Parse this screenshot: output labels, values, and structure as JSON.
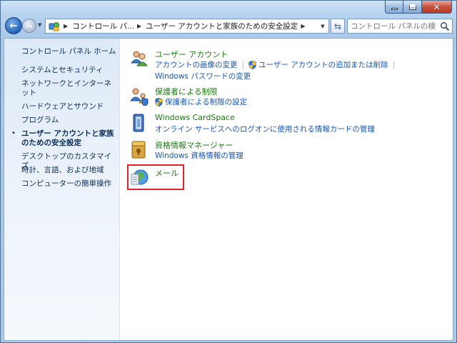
{
  "window": {
    "caption": {
      "close_glyph": "✕"
    }
  },
  "toolbar": {
    "address": {
      "segments": [
        "コントロール パ...",
        "ユーザー アカウントと家族のための安全設定"
      ]
    },
    "search": {
      "placeholder": "コントロール パネルの検索"
    }
  },
  "sidebar": {
    "items": [
      {
        "label": "コントロール パネル ホーム"
      },
      {
        "label": "システムとセキュリティ"
      },
      {
        "label": "ネットワークとインターネット"
      },
      {
        "label": "ハードウェアとサウンド"
      },
      {
        "label": "プログラム"
      },
      {
        "label": "ユーザー アカウントと家族のための安全設定",
        "current": true
      },
      {
        "label": "デスクトップのカスタマイズ"
      },
      {
        "label": "時計、言語、および地域"
      },
      {
        "label": "コンピューターの簡単操作"
      }
    ],
    "bullet": "•"
  },
  "categories": [
    {
      "title": "ユーザー アカウント",
      "icon": "users-icon",
      "links_row1": [
        "アカウントの画像の変更",
        "ユーザー アカウントの追加または削除"
      ],
      "links_row2": [
        "Windows パスワードの変更"
      ]
    },
    {
      "title": "保護者による制限",
      "icon": "parental-controls-icon",
      "links_row1": [
        "保護者による制限の設定"
      ]
    },
    {
      "title": "Windows CardSpace",
      "icon": "cardspace-icon",
      "links_row1": [
        "オンライン サービスへのログオンに使用される情報カードの管理"
      ]
    },
    {
      "title": "資格情報マネージャー",
      "icon": "credential-manager-icon",
      "links_row1": [
        "Windows 資格情報の管理"
      ]
    },
    {
      "title": "メール",
      "icon": "mail-icon",
      "highlighted": true
    }
  ],
  "colors": {
    "link": "#1a55b0",
    "category_title": "#1e7a14",
    "highlight": "#e0202a"
  }
}
